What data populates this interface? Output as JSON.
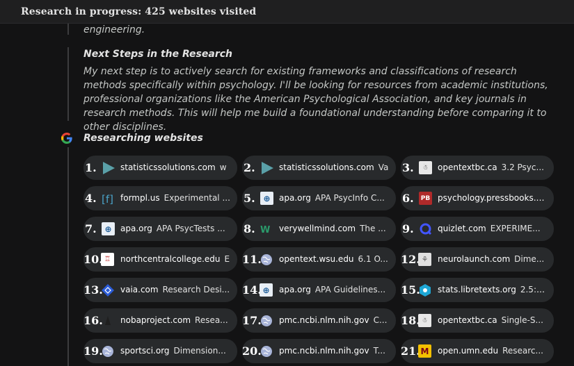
{
  "header": {
    "title": "Research in progress: 425 websites visited"
  },
  "thought": {
    "fragment": "engineering.",
    "heading": "Next Steps in the Research",
    "body": "My next step is to actively search for existing frameworks and classifications of research methods specifically within psychology. I'll be looking for resources from academic institutions, professional organizations like the American Psychological Association, and key journals in research methods. This will help me build a foundational understanding before comparing it to other disciplines."
  },
  "researching": {
    "heading": "Researching websites",
    "icon": "google-g-icon"
  },
  "sources": [
    {
      "num": "1.",
      "domain": "statisticssolutions.com",
      "title": "w",
      "icon": "play-triangle"
    },
    {
      "num": "2.",
      "domain": "statisticssolutions.com",
      "title": "Va",
      "icon": "play-triangle"
    },
    {
      "num": "3.",
      "domain": "opentextbc.ca",
      "title": "3.2 Psyc...",
      "icon": "opentext-logo"
    },
    {
      "num": "4.",
      "domain": "formpl.us",
      "title": "Experimental ...",
      "icon": "formplus-logo"
    },
    {
      "num": "5.",
      "domain": "apa.org",
      "title": "APA PsycInfo C...",
      "icon": "apa-logo"
    },
    {
      "num": "6.",
      "domain": "psychology.pressbooks.tru.ca",
      "title": "",
      "icon": "pressbooks-logo"
    },
    {
      "num": "7.",
      "domain": "apa.org",
      "title": "APA PsycTests ...",
      "icon": "apa-logo"
    },
    {
      "num": "8.",
      "domain": "verywellmind.com",
      "title": "The ...",
      "icon": "verywell-logo"
    },
    {
      "num": "9.",
      "domain": "quizlet.com",
      "title": "EXPERIME...",
      "icon": "quizlet-logo"
    },
    {
      "num": "10.",
      "domain": "northcentralcollege.edu",
      "title": "E",
      "icon": "college-logo"
    },
    {
      "num": "11.",
      "domain": "opentext.wsu.edu",
      "title": "6.1 O...",
      "icon": "globe"
    },
    {
      "num": "12.",
      "domain": "neurolaunch.com",
      "title": "Dime...",
      "icon": "brain-logo"
    },
    {
      "num": "13.",
      "domain": "vaia.com",
      "title": "Research Desi...",
      "icon": "vaia-logo"
    },
    {
      "num": "14.",
      "domain": "apa.org",
      "title": "APA Guidelines...",
      "icon": "apa-logo"
    },
    {
      "num": "15.",
      "domain": "stats.libretexts.org",
      "title": "2.5: ...",
      "icon": "libretexts-logo"
    },
    {
      "num": "16.",
      "domain": "nobaproject.com",
      "title": "Resea...",
      "icon": "noba-logo"
    },
    {
      "num": "17.",
      "domain": "pmc.ncbi.nlm.nih.gov",
      "title": "C...",
      "icon": "globe"
    },
    {
      "num": "18.",
      "domain": "opentextbc.ca",
      "title": "Single-S...",
      "icon": "opentext-logo"
    },
    {
      "num": "19.",
      "domain": "sportsci.org",
      "title": "Dimension...",
      "icon": "globe"
    },
    {
      "num": "20.",
      "domain": "pmc.ncbi.nlm.nih.gov",
      "title": "T...",
      "icon": "globe"
    },
    {
      "num": "21.",
      "domain": "open.umn.edu",
      "title": "Researc...",
      "icon": "umn-logo"
    }
  ]
}
